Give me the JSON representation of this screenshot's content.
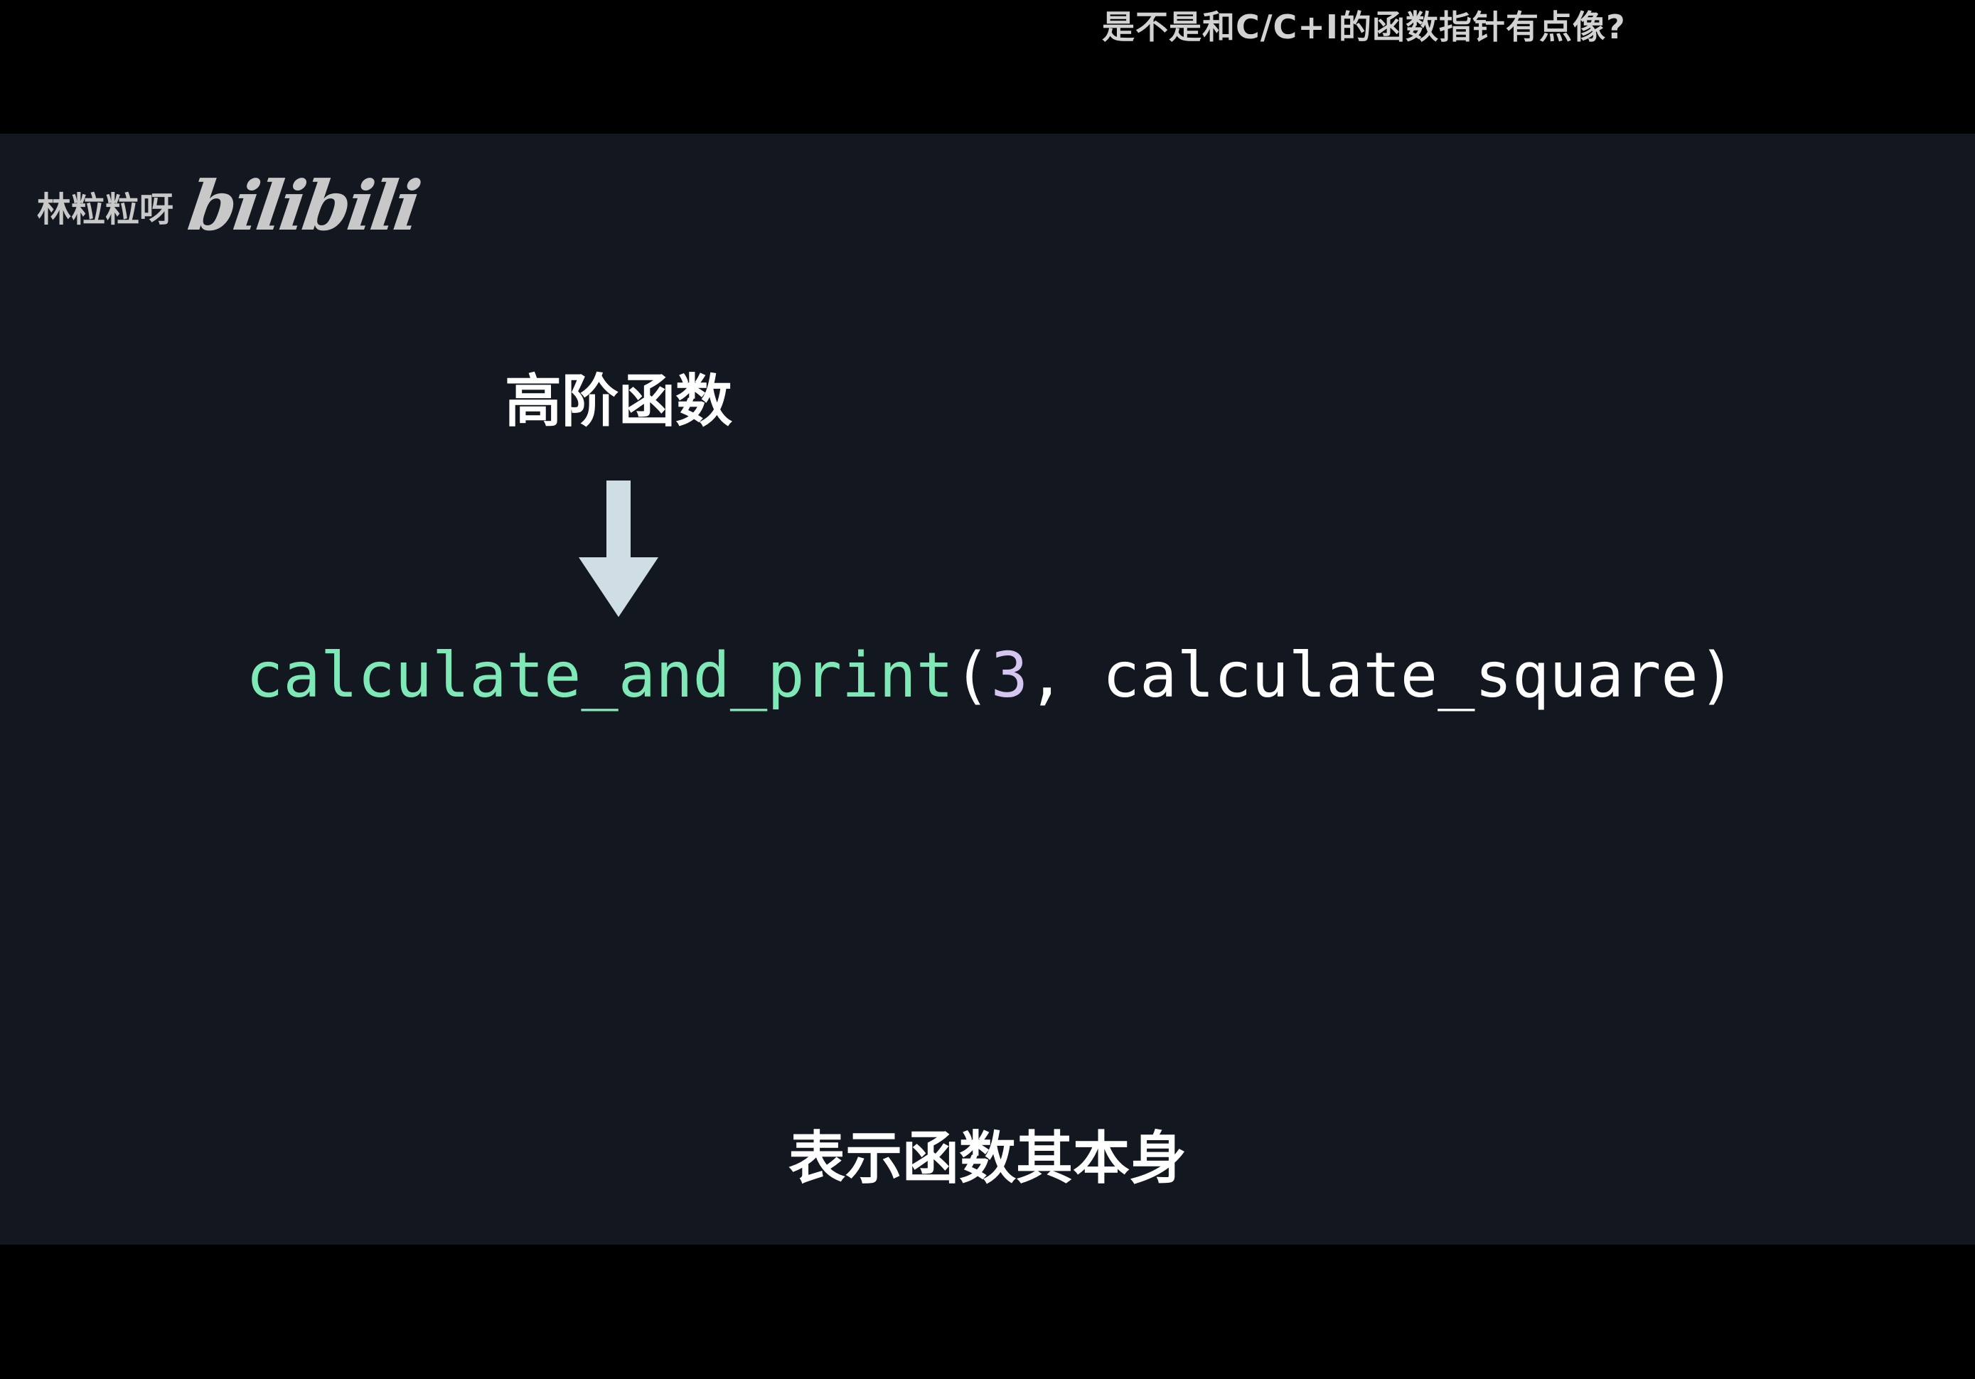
{
  "danmaku": {
    "text": "是不是和C/C+I的函数指针有点像?"
  },
  "watermark": {
    "author": "林粒粒呀",
    "logo": "bilibili",
    "logo_icon": "bilibili-logo-icon"
  },
  "slide": {
    "label": "高阶函数",
    "arrow_icon": "down-arrow-icon",
    "code": {
      "func_name": "calculate_and_print",
      "open_paren": "(",
      "number": "3",
      "comma": ", ",
      "arg_name": "calculate_square",
      "close_paren": ")"
    }
  },
  "subtitle": {
    "text": "表示函数其本身"
  },
  "colors": {
    "background": "#131720",
    "letterbox": "#000000",
    "function_name": "#7ee8b6",
    "number": "#d4c6f0",
    "arrow": "#cfdee4",
    "text": "#ffffff"
  }
}
